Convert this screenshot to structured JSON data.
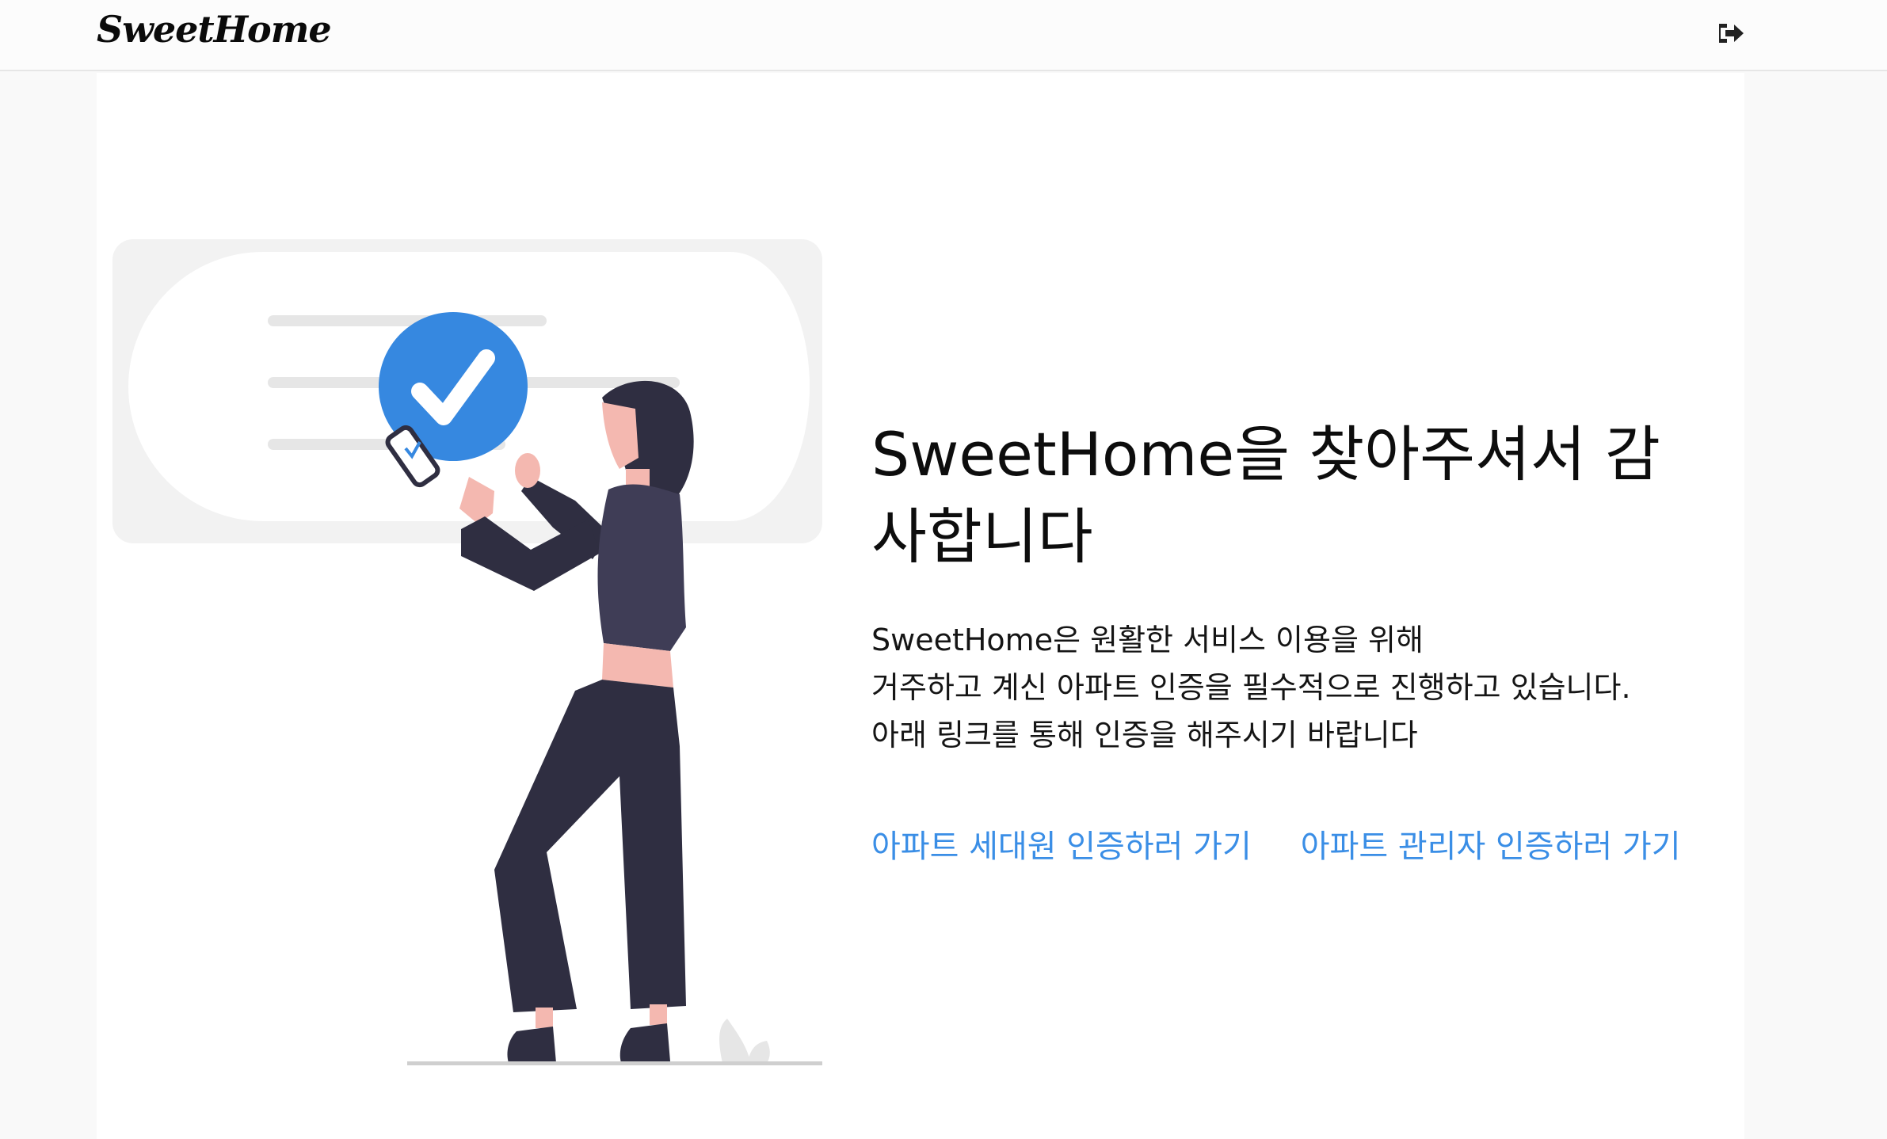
{
  "header": {
    "logo_text": "SweetHome",
    "logout_icon": "sign-out-icon"
  },
  "main": {
    "headline": "SweetHome을 찾아주셔서 감사합니다",
    "description_lines": [
      "SweetHome은 원활한 서비스 이용을 위해",
      "거주하고 계신 아파트 인증을 필수적으로 진행하고 있습니다.",
      "아래 링크를 통해 인증을 해주시기 바랍니다"
    ],
    "links": {
      "resident_label": "아파트 세대원 인증하러 가기",
      "manager_label": "아파트 관리자 인증하러 가기"
    }
  },
  "colors": {
    "accent": "#3a8ee6",
    "check_circle": "#3688e0",
    "figure_dark": "#2f2e41",
    "skin": "#f4b8b0"
  },
  "icons": {
    "check": "check-circle-icon",
    "illustration": "verified-woman-illustration"
  }
}
